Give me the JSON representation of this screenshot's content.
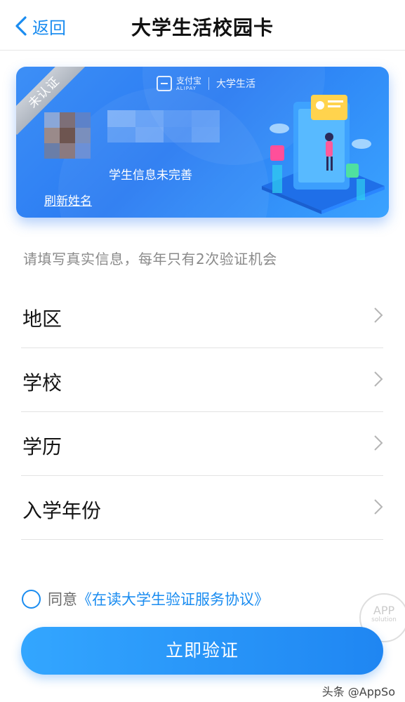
{
  "nav": {
    "back_label": "返回",
    "title": "大学生活校园卡"
  },
  "card": {
    "ribbon_text": "未认证",
    "brand_name": "支付宝",
    "brand_sub": "ALIPAY",
    "brand_section": "大学生活",
    "status_text": "学生信息未完善",
    "refresh_link": "刷新姓名",
    "colors": {
      "primary": "#2a7bf2",
      "light": "#3aa3ff"
    }
  },
  "hint": "请填写真实信息，每年只有2次验证机会",
  "form": {
    "rows": [
      {
        "label": "地区"
      },
      {
        "label": "学校"
      },
      {
        "label": "学历"
      },
      {
        "label": "入学年份"
      }
    ]
  },
  "agreement": {
    "prefix": "同意",
    "link_text": "《在读大学生验证服务协议》",
    "checked": false
  },
  "watermark": {
    "line1": "APP",
    "line2": "solution"
  },
  "verify_button": "立即验证",
  "footer_mark": "头条 @AppSo",
  "accent_color": "#1a8cf0"
}
